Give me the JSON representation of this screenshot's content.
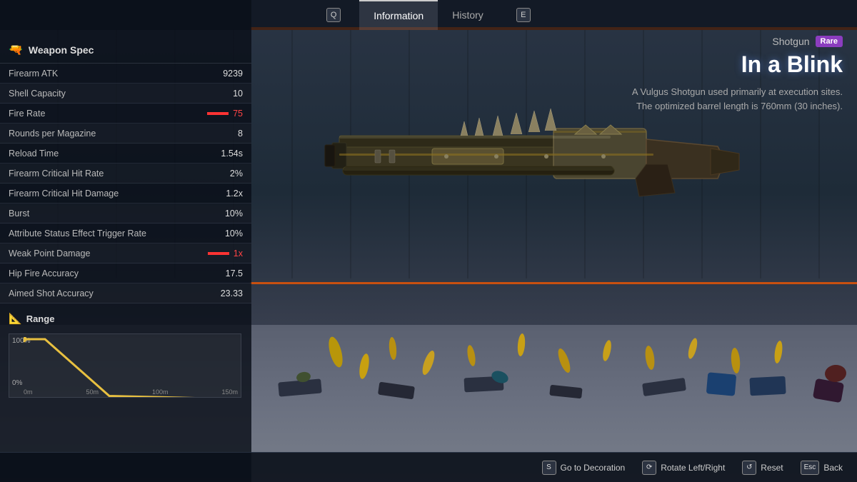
{
  "nav": {
    "q_key": "Q",
    "active_tab": "Information",
    "history_tab": "History",
    "e_key": "E"
  },
  "weapon_spec": {
    "header": "Weapon Spec",
    "stats": [
      {
        "label": "Firearm ATK",
        "value": "9239",
        "type": "normal"
      },
      {
        "label": "Shell Capacity",
        "value": "10",
        "type": "normal"
      },
      {
        "label": "Fire Rate",
        "value": "75",
        "type": "bar"
      },
      {
        "label": "Rounds per Magazine",
        "value": "8",
        "type": "normal"
      },
      {
        "label": "Reload Time",
        "value": "1.54s",
        "type": "normal"
      },
      {
        "label": "Firearm Critical Hit Rate",
        "value": "2%",
        "type": "normal"
      },
      {
        "label": "Firearm Critical Hit Damage",
        "value": "1.2x",
        "type": "normal"
      },
      {
        "label": "Burst",
        "value": "10%",
        "type": "normal"
      },
      {
        "label": "Attribute Status Effect Trigger Rate",
        "value": "10%",
        "type": "normal"
      },
      {
        "label": "Weak Point Damage",
        "value": "1x",
        "type": "bar2"
      },
      {
        "label": "Hip Fire Accuracy",
        "value": "17.5",
        "type": "normal"
      },
      {
        "label": "Aimed Shot Accuracy",
        "value": "23.33",
        "type": "normal"
      }
    ]
  },
  "range": {
    "header": "Range",
    "chart": {
      "y_max": "100%",
      "y_min": "0%",
      "x_labels": [
        "0m",
        "50m",
        "100m",
        "150m"
      ]
    }
  },
  "weapon_info": {
    "type": "Shotgun",
    "rarity": "Rare",
    "name": "In a Blink",
    "description": "A Vulgus Shotgun used primarily at execution sites. The optimized barrel length is 760mm (30 inches)."
  },
  "bottom_bar": {
    "actions": [
      {
        "key": "S",
        "label": "Go to Decoration"
      },
      {
        "key": "⟳",
        "label": "Rotate Left/Right"
      },
      {
        "key": "↺",
        "label": "Reset"
      },
      {
        "key": "Esc",
        "label": "Back"
      }
    ]
  },
  "colors": {
    "accent_orange": "#c85010",
    "rare_purple": "#8b3dbf",
    "bar_red": "#ff3333",
    "panel_bg": "rgba(10,15,25,0.82)"
  }
}
